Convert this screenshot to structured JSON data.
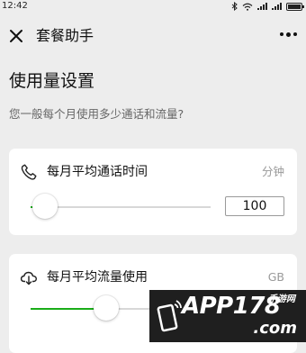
{
  "status_bar": {
    "time": "12:42",
    "icons": [
      "bluetooth-icon",
      "wifi-icon",
      "signal-icon",
      "signal-icon",
      "battery-icon"
    ]
  },
  "nav": {
    "title": "套餐助手",
    "close_icon": "close-icon",
    "more_icon": "more-icon"
  },
  "page": {
    "title": "使用量设置",
    "subtitle": "您一般每个月使用多少通话和流量?"
  },
  "cards": [
    {
      "title": "每月平均通话时间",
      "unit": "分钟",
      "icon": "phone-icon",
      "slider_value_fraction": 0.08,
      "input_value": "100"
    },
    {
      "title": "每月平均流量使用",
      "unit": "GB",
      "icon": "cloud-download-icon",
      "slider_value_fraction": 0.42
    }
  ],
  "watermark": {
    "brand": "APP178",
    "sub": "手游网",
    "domain": ".com"
  },
  "colors": {
    "accent": "#1aad19",
    "background": "#ededed",
    "card": "#ffffff"
  }
}
